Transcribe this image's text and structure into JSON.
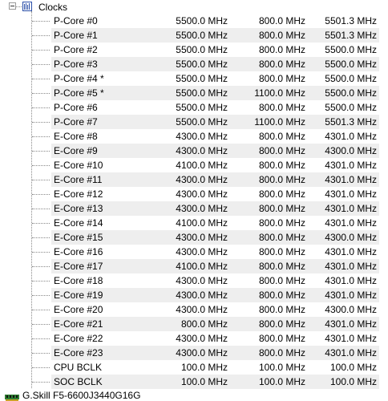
{
  "header": {
    "title": "Clocks",
    "expander_icon": "collapse-minus-icon",
    "icon": "clock-bars-icon"
  },
  "rows": [
    {
      "name": "P-Core #0",
      "current": "5500.0 MHz",
      "min": "800.0 MHz",
      "max": "5501.3 MHz"
    },
    {
      "name": "P-Core #1",
      "current": "5500.0 MHz",
      "min": "800.0 MHz",
      "max": "5501.3 MHz"
    },
    {
      "name": "P-Core #2",
      "current": "5500.0 MHz",
      "min": "800.0 MHz",
      "max": "5500.0 MHz"
    },
    {
      "name": "P-Core #3",
      "current": "5500.0 MHz",
      "min": "800.0 MHz",
      "max": "5500.0 MHz"
    },
    {
      "name": "P-Core #4 *",
      "current": "5500.0 MHz",
      "min": "800.0 MHz",
      "max": "5500.0 MHz"
    },
    {
      "name": "P-Core #5 *",
      "current": "5500.0 MHz",
      "min": "1100.0 MHz",
      "max": "5500.0 MHz"
    },
    {
      "name": "P-Core #6",
      "current": "5500.0 MHz",
      "min": "800.0 MHz",
      "max": "5500.0 MHz"
    },
    {
      "name": "P-Core #7",
      "current": "5500.0 MHz",
      "min": "1100.0 MHz",
      "max": "5501.3 MHz"
    },
    {
      "name": "E-Core #8",
      "current": "4300.0 MHz",
      "min": "800.0 MHz",
      "max": "4301.0 MHz"
    },
    {
      "name": "E-Core #9",
      "current": "4300.0 MHz",
      "min": "800.0 MHz",
      "max": "4300.0 MHz"
    },
    {
      "name": "E-Core #10",
      "current": "4100.0 MHz",
      "min": "800.0 MHz",
      "max": "4301.0 MHz"
    },
    {
      "name": "E-Core #11",
      "current": "4300.0 MHz",
      "min": "800.0 MHz",
      "max": "4301.0 MHz"
    },
    {
      "name": "E-Core #12",
      "current": "4300.0 MHz",
      "min": "800.0 MHz",
      "max": "4301.0 MHz"
    },
    {
      "name": "E-Core #13",
      "current": "4300.0 MHz",
      "min": "800.0 MHz",
      "max": "4301.0 MHz"
    },
    {
      "name": "E-Core #14",
      "current": "4100.0 MHz",
      "min": "800.0 MHz",
      "max": "4301.0 MHz"
    },
    {
      "name": "E-Core #15",
      "current": "4300.0 MHz",
      "min": "800.0 MHz",
      "max": "4300.0 MHz"
    },
    {
      "name": "E-Core #16",
      "current": "4300.0 MHz",
      "min": "800.0 MHz",
      "max": "4301.0 MHz"
    },
    {
      "name": "E-Core #17",
      "current": "4100.0 MHz",
      "min": "800.0 MHz",
      "max": "4301.0 MHz"
    },
    {
      "name": "E-Core #18",
      "current": "4300.0 MHz",
      "min": "800.0 MHz",
      "max": "4301.0 MHz"
    },
    {
      "name": "E-Core #19",
      "current": "4300.0 MHz",
      "min": "800.0 MHz",
      "max": "4301.0 MHz"
    },
    {
      "name": "E-Core #20",
      "current": "4300.0 MHz",
      "min": "800.0 MHz",
      "max": "4300.0 MHz"
    },
    {
      "name": "E-Core #21",
      "current": "800.0 MHz",
      "min": "800.0 MHz",
      "max": "4301.0 MHz"
    },
    {
      "name": "E-Core #22",
      "current": "4300.0 MHz",
      "min": "800.0 MHz",
      "max": "4301.0 MHz"
    },
    {
      "name": "E-Core #23",
      "current": "4300.0 MHz",
      "min": "800.0 MHz",
      "max": "4301.0 MHz"
    },
    {
      "name": "CPU BCLK",
      "current": "100.0 MHz",
      "min": "100.0 MHz",
      "max": "100.0 MHz"
    },
    {
      "name": "SOC BCLK",
      "current": "100.0 MHz",
      "min": "100.0 MHz",
      "max": "100.0 MHz"
    }
  ],
  "footer": {
    "label": "G.Skill F5-6600J3440G16G",
    "icon": "memory-module-icon"
  },
  "colors": {
    "row_alt_bg": "#eeeeee",
    "tree_line": "#888888",
    "ram_icon_green": "#2e7d32"
  }
}
